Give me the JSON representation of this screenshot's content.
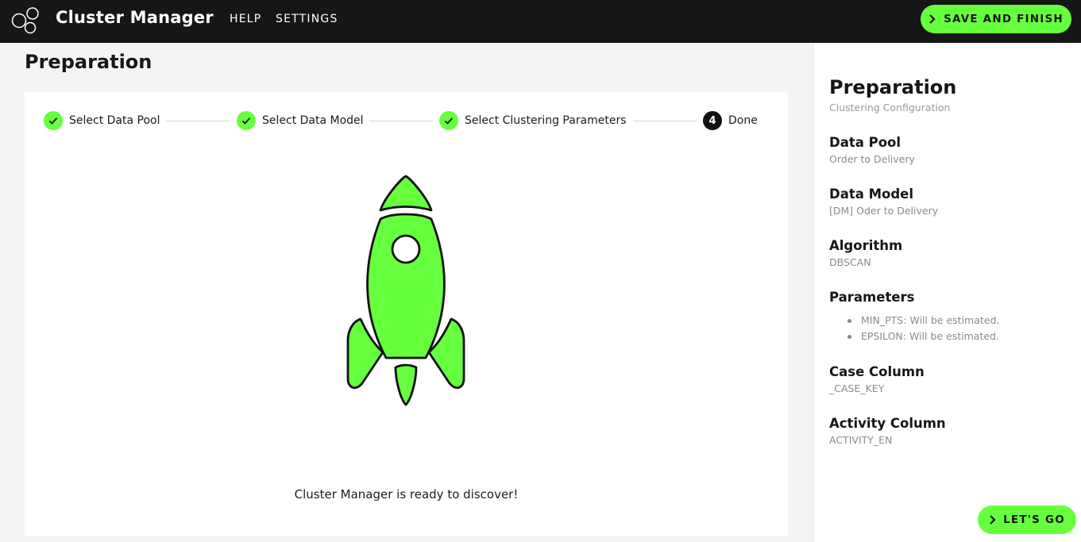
{
  "app": {
    "title": "Cluster Manager",
    "logo_icon": "bubbles-logo-icon"
  },
  "nav": {
    "help": "HELP",
    "settings": "SETTINGS"
  },
  "header_actions": {
    "save_label": "SAVE AND FINISH",
    "save_icon": "chevron-right-icon"
  },
  "page": {
    "title": "Preparation"
  },
  "stepper": {
    "steps": [
      {
        "label": "Select Data Pool",
        "state": "completed",
        "icon": "check-icon"
      },
      {
        "label": "Select Data Model",
        "state": "completed",
        "icon": "check-icon"
      },
      {
        "label": "Select Clustering Parameters",
        "state": "completed",
        "icon": "check-icon"
      },
      {
        "label": "Done",
        "state": "active",
        "number": "4"
      }
    ]
  },
  "main": {
    "illustration": "rocket-icon",
    "message": "Cluster Manager is ready to discover!"
  },
  "summary": {
    "title": "Preparation",
    "subtitle": "Clustering Configuration",
    "data_pool": {
      "heading": "Data Pool",
      "value": "Order to Delivery"
    },
    "data_model": {
      "heading": "Data Model",
      "value": "[DM] Oder to Delivery"
    },
    "algorithm": {
      "heading": "Algorithm",
      "value": "DBSCAN"
    },
    "parameters": {
      "heading": "Parameters",
      "items": [
        "MIN_PTS: Will be estimated.",
        "EPSILON: Will be estimated."
      ]
    },
    "case_column": {
      "heading": "Case Column",
      "value": "_CASE_KEY"
    },
    "activity_column": {
      "heading": "Activity Column",
      "value": "ACTIVITY_EN"
    }
  },
  "footer_actions": {
    "go_label": "LET'S GO",
    "go_icon": "chevron-right-icon"
  },
  "colors": {
    "accent": "#66ff3e",
    "topbar": "#161616",
    "muted": "#8a8a8a"
  }
}
